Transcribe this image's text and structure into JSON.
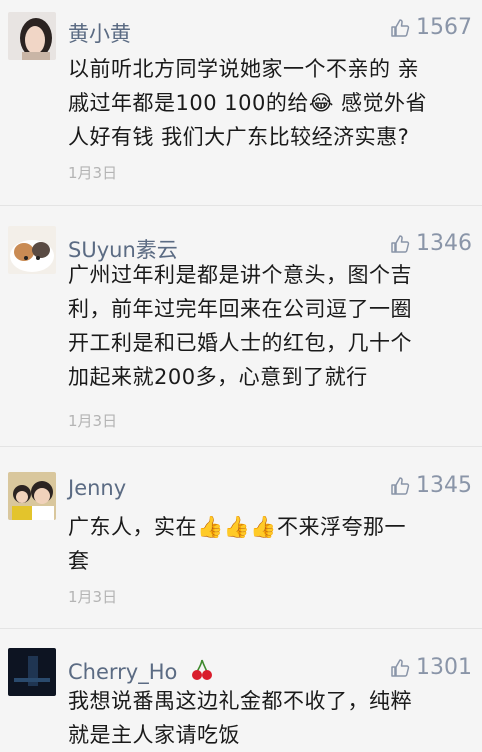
{
  "comments": [
    {
      "username": "黄小黄",
      "likes": "1567",
      "text": [
        "以前听北方同学说她家一个不亲的 亲",
        "戚过年都是100 100的给😂 感觉外省",
        "人好有钱 我们大广东比较经济实惠?"
      ],
      "date": "1月3日"
    },
    {
      "username": "SUyun素云",
      "likes": "1346",
      "text": [
        "广州过年利是都是讲个意头，图个吉",
        "利，前年过完年回来在公司逗了一圈",
        "开工利是和已婚人士的红包，几十个",
        "加起来就200多，心意到了就行"
      ],
      "date": "1月3日"
    },
    {
      "username": "Jenny",
      "likes": "1345",
      "text": [
        "广东人，实在👍👍👍不来浮夸那一",
        "套"
      ],
      "date": "1月3日"
    },
    {
      "username": "Cherry_Ho",
      "likes": "1301",
      "text": [
        "我想说番禺这边礼金都不收了，纯粹",
        "就是主人家请吃饭"
      ],
      "date": ""
    }
  ],
  "colors": {
    "username": "#5b6b83",
    "likes": "#8a95a8",
    "date": "#b4b4b4",
    "background": "#f5f5f5"
  },
  "icons": {
    "like": "thumbs-up-icon",
    "emoji_laugh": "tears-of-joy-emoji",
    "emoji_thumb": "thumbs-up-emoji",
    "emoji_cherry": "cherries-emoji"
  }
}
